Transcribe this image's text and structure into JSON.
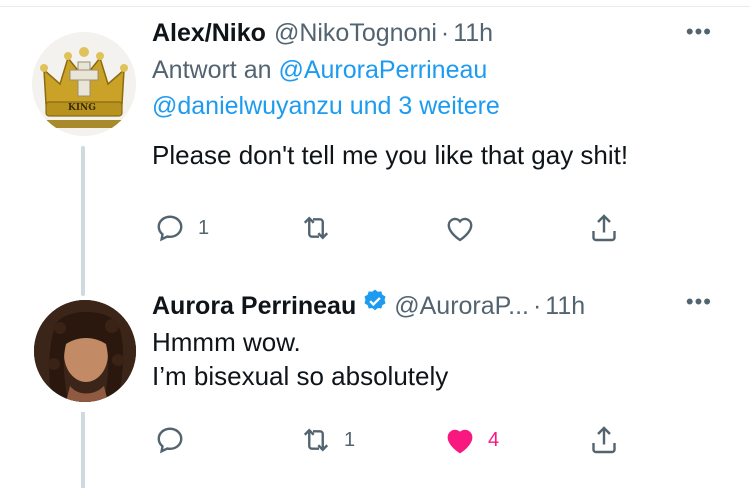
{
  "tweets": [
    {
      "name": "Alex/Niko",
      "handle": "@NikoTognoni",
      "time": "11h",
      "reply_prefix": "Antwort an",
      "reply_mention_1": "@AuroraPerrineau",
      "reply_mention_2": "@danielwuyanzu",
      "reply_suffix": "und 3 weitere",
      "text": "Please don't tell me you like that gay shit!",
      "avatar_label": "KING",
      "reply_count": "1",
      "retweet_count": "",
      "like_count": "",
      "more": "•••"
    },
    {
      "name": "Aurora Perrineau",
      "handle": "@AuroraP...",
      "time": "11h",
      "verified": true,
      "text_line1": "Hmmm wow.",
      "text_line2": "I’m bisexual so absolutely",
      "reply_count": "",
      "retweet_count": "1",
      "like_count": "4",
      "liked": true,
      "more": "•••"
    }
  ],
  "colors": {
    "accent": "#1d9bf0",
    "like": "#f91880",
    "muted": "#536471",
    "text": "#0f1419"
  },
  "separator": "·"
}
